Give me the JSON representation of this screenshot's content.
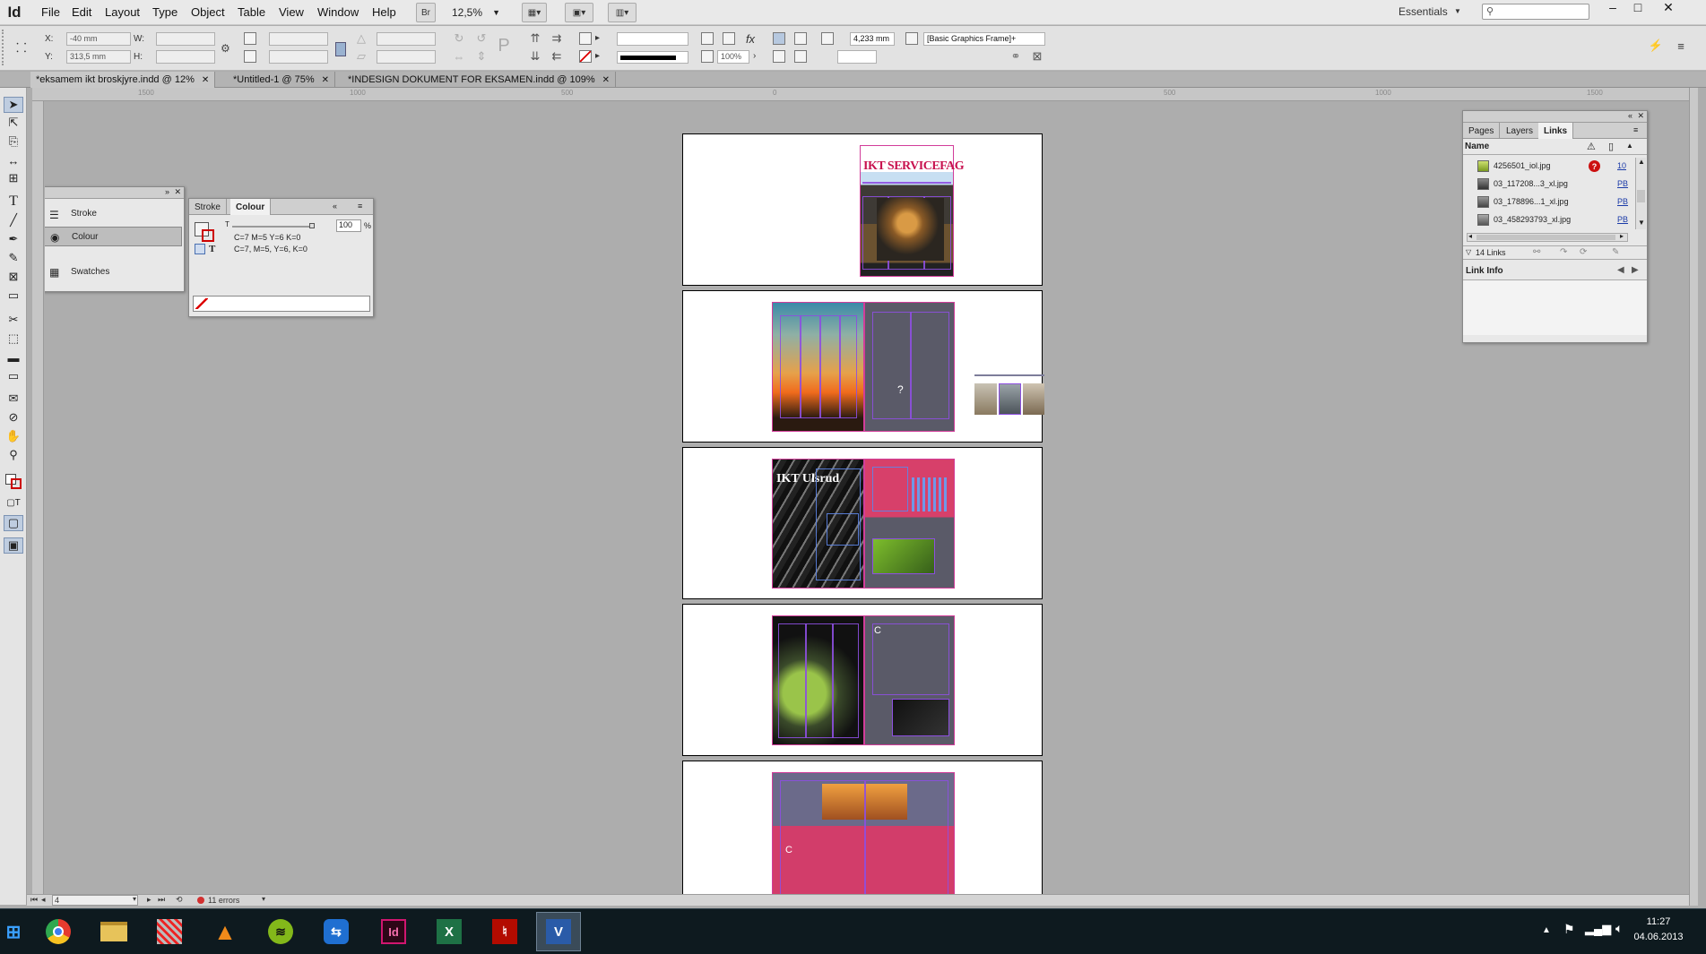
{
  "app": {
    "icon_text": "Id",
    "menu": [
      "File",
      "Edit",
      "Layout",
      "Type",
      "Object",
      "Table",
      "View",
      "Window",
      "Help"
    ],
    "bridge_label": "Br",
    "zoom": "12,5%",
    "workspace": "Essentials",
    "window_buttons": [
      "–",
      "□",
      "✕"
    ]
  },
  "control": {
    "x_label": "X:",
    "x_value": "-40 mm",
    "y_label": "Y:",
    "y_value": "313,5 mm",
    "w_label": "W:",
    "h_label": "H:",
    "percent_1": "100%",
    "stroke_weight": "4,233 mm",
    "object_style": "[Basic Graphics Frame]+"
  },
  "tabs": [
    {
      "label": "*eksamem ikt broskjyre.indd @ 12%",
      "active": true
    },
    {
      "label": "*Untitled-1 @ 75%",
      "active": false
    },
    {
      "label": "*INDESIGN DOKUMENT FOR EKSAMEN.indd @ 109%",
      "active": false
    }
  ],
  "ruler": {
    "ticks": [
      "1500",
      "1000",
      "500",
      "0",
      "500",
      "1000",
      "1500"
    ]
  },
  "stroke_panel": {
    "items": [
      {
        "label": "Stroke",
        "icon": "stroke-icon"
      },
      {
        "label": "Colour",
        "icon": "colour-icon"
      },
      {
        "label": "Swatches",
        "icon": "swatches-icon"
      }
    ]
  },
  "colour_panel": {
    "tab_stroke": "Stroke",
    "tab_colour": "Colour",
    "tint_label": "T",
    "tint_value": "100",
    "tint_unit": "%",
    "line1": "C=7 M=5 Y=6 K=0",
    "line2": "C=7, M=5, Y=6, K=0",
    "text_icon": "T"
  },
  "links_panel": {
    "tabs": [
      "Pages",
      "Layers",
      "Links"
    ],
    "col_name": "Name",
    "rows": [
      {
        "name": "4256501_iol.jpg",
        "page": "10",
        "status": "missing"
      },
      {
        "name": "03_117208...3_xl.jpg",
        "page": "PB",
        "status": "ok"
      },
      {
        "name": "03_178896...1_xl.jpg",
        "page": "PB",
        "status": "ok"
      },
      {
        "name": "03_458293793_xl.jpg",
        "page": "PB",
        "status": "ok"
      }
    ],
    "count": "14 Links",
    "link_info": "Link Info"
  },
  "document": {
    "page1_title": "IKT SERVICEFAG",
    "page3_title": "IKT Ulsrud",
    "glyph_p2": "?",
    "glyph_p4": "C",
    "glyph_p5": "C"
  },
  "status": {
    "page": "4",
    "errors": "11 errors"
  },
  "taskbar": {
    "apps": [
      "chrome",
      "explorer",
      "media",
      "vlc",
      "spotify",
      "teamviewer",
      "indesign",
      "excel",
      "acrobat",
      "visio"
    ],
    "time": "11:27",
    "date": "04.06.2013"
  },
  "colors": {
    "accent_pink": "#d23d9a",
    "guide_purple": "#8d4fe0",
    "error_red": "#cc1010",
    "link_blue": "#1a3aa8"
  }
}
